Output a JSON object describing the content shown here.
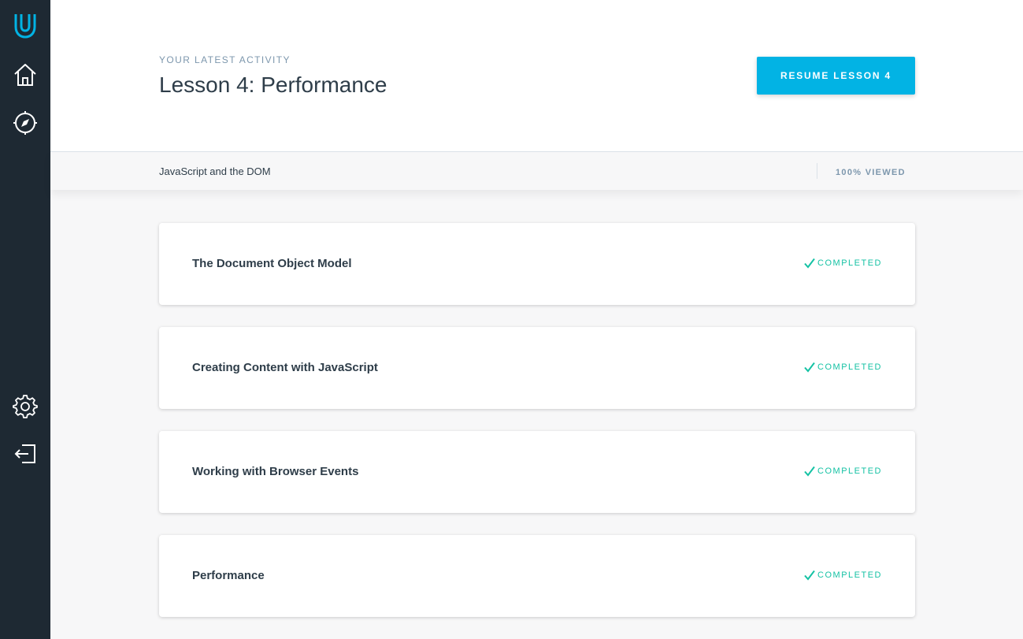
{
  "sidebar": {
    "icons": [
      "udacity-logo-icon",
      "home-icon",
      "compass-icon",
      "settings-icon",
      "logout-icon"
    ]
  },
  "header": {
    "eyebrow": "YOUR LATEST ACTIVITY",
    "title": "Lesson 4: Performance",
    "resume_label": "RESUME LESSON 4"
  },
  "subbar": {
    "course_name": "JavaScript and the DOM",
    "progress": "100% VIEWED"
  },
  "lessons": [
    {
      "title": "The Document Object Model",
      "status": "COMPLETED"
    },
    {
      "title": "Creating Content with JavaScript",
      "status": "COMPLETED"
    },
    {
      "title": "Working with Browser Events",
      "status": "COMPLETED"
    },
    {
      "title": "Performance",
      "status": "COMPLETED"
    }
  ],
  "colors": {
    "accent": "#02b3e4",
    "sidebar": "#1e2933",
    "completed": "#15c2a4"
  }
}
